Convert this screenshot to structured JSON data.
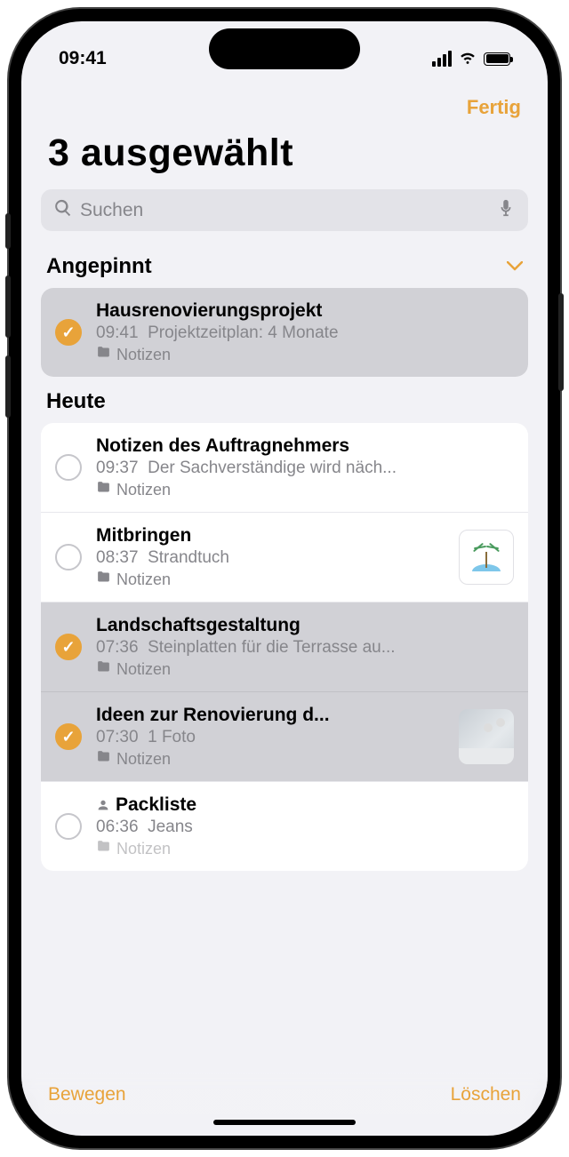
{
  "status": {
    "time": "09:41"
  },
  "nav": {
    "done": "Fertig"
  },
  "header": {
    "title": "3 ausgewählt"
  },
  "search": {
    "placeholder": "Suchen"
  },
  "sections": {
    "pinned": {
      "label": "Angepinnt"
    },
    "today": {
      "label": "Heute"
    }
  },
  "notes": {
    "pinned": [
      {
        "title": "Hausrenovierungsprojekt",
        "time": "09:41",
        "preview": "Projektzeitplan: 4 Monate",
        "folder": "Notizen",
        "selected": true
      }
    ],
    "today": [
      {
        "title": "Notizen des Auftragnehmers",
        "time": "09:37",
        "preview": "Der Sachverständige wird näch...",
        "folder": "Notizen",
        "selected": false
      },
      {
        "title": "Mitbringen",
        "time": "08:37",
        "preview": "Strandtuch",
        "folder": "Notizen",
        "selected": false,
        "thumb": "palm"
      },
      {
        "title": "Landschaftsgestaltung",
        "time": "07:36",
        "preview": "Steinplatten für die Terrasse au...",
        "folder": "Notizen",
        "selected": true
      },
      {
        "title": "Ideen zur Renovierung d...",
        "time": "07:30",
        "preview": "1 Foto",
        "folder": "Notizen",
        "selected": true,
        "thumb": "photo"
      },
      {
        "title": "Packliste",
        "time": "06:36",
        "preview": "Jeans",
        "folder": "Notizen",
        "selected": false,
        "shared": true
      }
    ]
  },
  "toolbar": {
    "move": "Bewegen",
    "delete": "Löschen"
  }
}
